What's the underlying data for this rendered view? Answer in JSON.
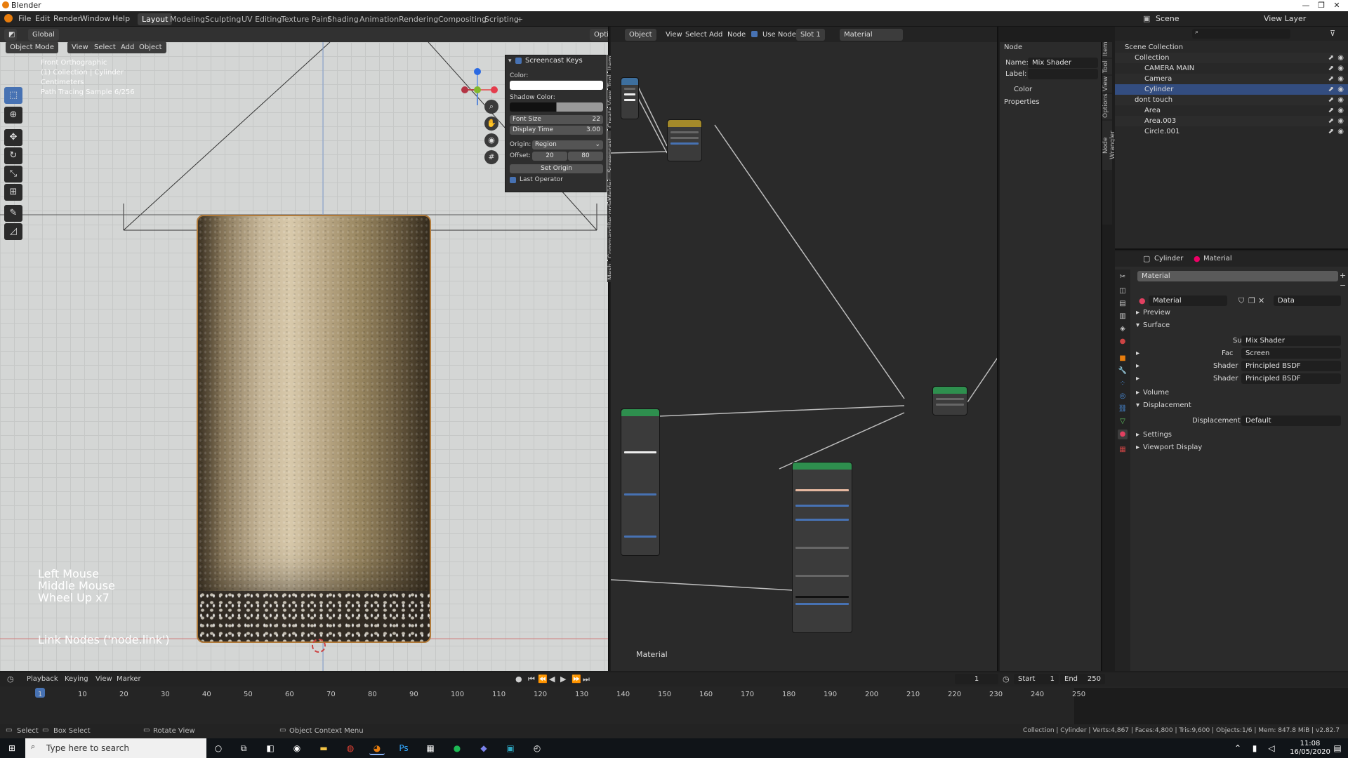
{
  "window": {
    "title": "Blender"
  },
  "menu": [
    "File",
    "Edit",
    "Render",
    "Window",
    "Help"
  ],
  "workspaces": [
    "Layout",
    "Modeling",
    "Sculpting",
    "UV Editing",
    "Texture Paint",
    "Shading",
    "Animation",
    "Rendering",
    "Compositing",
    "Scripting",
    "+"
  ],
  "topbar": {
    "scene_label": "Scene",
    "view_layer_label": "View Layer",
    "transform_orientation": "Global",
    "options_label": "Options"
  },
  "viewport": {
    "mode": "Object Mode",
    "menus": [
      "View",
      "Select",
      "Add",
      "Object"
    ],
    "info": [
      "Front Orthographic",
      "(1) Collection | Cylinder",
      "Centimeters",
      "Path Tracing Sample 6/256"
    ],
    "keys": [
      "Left Mouse",
      "Middle Mouse",
      "Wheel Up x7"
    ],
    "operator": "Link Nodes ('node.link')",
    "gizmo": {
      "x": "X",
      "y": "Y",
      "z": "Z"
    }
  },
  "screencast": {
    "title": "Screencast Keys",
    "color_label": "Color:",
    "shadow_label": "Shadow Color:",
    "font_size_label": "Font Size",
    "font_size": "22",
    "display_time_label": "Display Time",
    "display_time": "3.00",
    "origin_label": "Origin:",
    "origin": "Region",
    "offset_label": "Offset:",
    "offset_x": "20",
    "offset_y": "80",
    "set_origin": "Set Origin",
    "last_operator": "Last Operator",
    "side_tabs": [
      "Item",
      "Tool",
      "View",
      "Create",
      "Screencast Keys",
      "Welder",
      "CommandRecorder",
      "Mesh"
    ]
  },
  "node_editor": {
    "object_label": "Object",
    "menus": [
      "View",
      "Select",
      "Add",
      "Node"
    ],
    "use_nodes": "Use Nodes",
    "slot": "Slot 1",
    "material": "Material",
    "footer_label": "Material"
  },
  "npanel": {
    "section_node": "Node",
    "name_label": "Name:",
    "name_value": "Mix Shader",
    "label_label": "Label:",
    "color_label": "Color",
    "properties_label": "Properties",
    "tabs": [
      "Item",
      "Tool",
      "View",
      "Options",
      "Node Wrangler"
    ]
  },
  "outliner": {
    "rows": [
      {
        "label": "Scene Collection",
        "indent": 0
      },
      {
        "label": "Collection",
        "indent": 1
      },
      {
        "label": "CAMERA MAIN",
        "indent": 2
      },
      {
        "label": "Camera",
        "indent": 2
      },
      {
        "label": "Cylinder",
        "indent": 2,
        "selected": true
      },
      {
        "label": "dont touch",
        "indent": 1
      },
      {
        "label": "Area",
        "indent": 2
      },
      {
        "label": "Area.003",
        "indent": 2
      },
      {
        "label": "Circle.001",
        "indent": 2
      }
    ]
  },
  "properties": {
    "object": "Cylinder",
    "material_tab": "Material",
    "slot_name": "Material",
    "material_name": "Material",
    "link": "Data",
    "sections": {
      "preview": "Preview",
      "surface": "Surface",
      "volume": "Volume",
      "displacement": "Displacement",
      "settings": "Settings",
      "viewport_display": "Viewport Display"
    },
    "surface_label": "Surface",
    "surface_value": "Mix Shader",
    "fac_label": "Fac",
    "fac_value": "Screen",
    "shader1_label": "Shader",
    "shader1_value": "Principled BSDF",
    "shader2_label": "Shader",
    "shader2_value": "Principled BSDF",
    "displacement_label": "Displacement",
    "displacement_value": "Default"
  },
  "timeline": {
    "menus": [
      "Playback",
      "Keying",
      "View",
      "Marker"
    ],
    "current_frame": "1",
    "start_label": "Start",
    "start": "1",
    "end_label": "End",
    "end": "250",
    "ticks": [
      "1",
      "10",
      "20",
      "30",
      "40",
      "50",
      "60",
      "70",
      "80",
      "90",
      "100",
      "110",
      "120",
      "130",
      "140",
      "150",
      "160",
      "170",
      "180",
      "190",
      "200",
      "210",
      "220",
      "230",
      "240",
      "250"
    ]
  },
  "status": {
    "select": "Select",
    "box_select": "Box Select",
    "rotate_view": "Rotate View",
    "context_menu": "Object Context Menu",
    "stats": "Collection | Cylinder | Verts:4,867 | Faces:4,800 | Tris:9,600 | Objects:1/6 | Mem: 847.8 MiB | v2.82.7"
  },
  "taskbar": {
    "search_placeholder": "Type here to search",
    "time": "11:08",
    "date": "16/05/2020"
  }
}
